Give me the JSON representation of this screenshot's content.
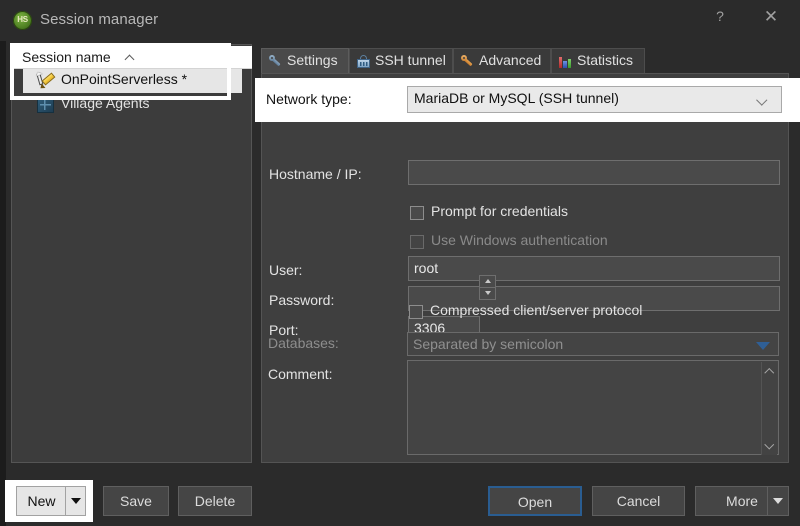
{
  "window": {
    "title": "Session manager",
    "logo_text": "HS",
    "help_glyph": "?",
    "close_glyph": "✕"
  },
  "sessions": {
    "header": "Session name",
    "sort_indicator": "ascending",
    "items": [
      {
        "label": "OnPointServerless *",
        "icon": "session-edit-icon",
        "selected": true
      },
      {
        "label": "Village Agents",
        "icon": "database-icon",
        "selected": false
      }
    ]
  },
  "tabs": [
    {
      "label": "Settings",
      "icon": "wrench-blue-icon",
      "active": true
    },
    {
      "label": "SSH tunnel",
      "icon": "lock-icon",
      "active": false
    },
    {
      "label": "Advanced",
      "icon": "wrench-orange-icon",
      "active": false
    },
    {
      "label": "Statistics",
      "icon": "bar-chart-icon",
      "active": false
    }
  ],
  "settings": {
    "network_type": {
      "label": "Network type:",
      "value": "MariaDB or MySQL (SSH tunnel)",
      "highlighted": true
    },
    "hostname": {
      "label": "Hostname / IP:",
      "value": ""
    },
    "prompt_for_credentials": {
      "label": "Prompt for credentials",
      "checked": false,
      "enabled": true
    },
    "use_windows_auth": {
      "label": "Use Windows authentication",
      "checked": false,
      "enabled": false
    },
    "user": {
      "label": "User:",
      "value": "root"
    },
    "password": {
      "label": "Password:",
      "value": ""
    },
    "port": {
      "label": "Port:",
      "value": "3306"
    },
    "compressed_protocol": {
      "label": "Compressed client/server protocol",
      "checked": false,
      "enabled": true
    },
    "databases": {
      "label": "Databases:",
      "placeholder": "Separated by semicolon",
      "value": ""
    },
    "comment": {
      "label": "Comment:",
      "value": ""
    }
  },
  "buttons": {
    "new": {
      "label": "New",
      "has_dropdown": true,
      "highlighted": true
    },
    "save": {
      "label": "Save"
    },
    "delete": {
      "label": "Delete"
    },
    "open": {
      "label": "Open",
      "is_default": true
    },
    "cancel": {
      "label": "Cancel"
    },
    "more": {
      "label": "More",
      "has_dropdown": true
    }
  },
  "colors": {
    "window_bg": "#2b2b2b",
    "panel_bg": "#3f3f3f",
    "accent_default_button": "#2a5d91",
    "highlight_overlay": "#ffffff",
    "dropdown_arrow_blue": "#2f5f96"
  }
}
